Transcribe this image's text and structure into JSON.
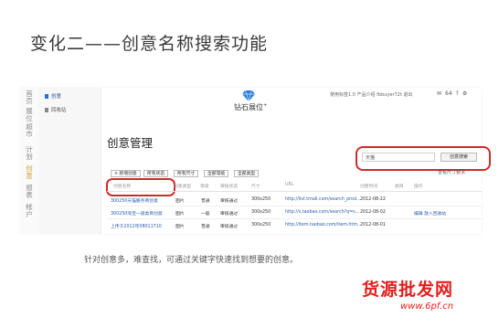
{
  "slide": {
    "title": "变化二——创意名称搜索功能",
    "caption": "针对创意多，难查找，可通过关键字快速找到想要的创意。"
  },
  "watermark": {
    "main": "货源批发网",
    "url": "www.6pf.cn"
  },
  "app": {
    "left_nav": [
      "首页",
      "展位超市",
      "计划",
      "创意",
      "报表",
      "帐户"
    ],
    "left_nav_active": "创意",
    "sub_nav": [
      "创意",
      "回收站"
    ],
    "logo_text": "钻石展位",
    "logo_sup": "+",
    "top_links": "使用标签1.0   产品介绍   fbbuyer72t   退出",
    "top_counts": "64",
    "page_title": "创意管理",
    "search": {
      "value": "天猫",
      "button": "创意搜索"
    },
    "size_link": "查看尺寸要求",
    "toolbar": [
      "+ 新增创意",
      "所有状态",
      "所有尺寸",
      "全部等级",
      "全部类型"
    ],
    "table": {
      "headers": [
        "创意名称",
        "创意类型",
        "等级",
        "审核状态",
        "尺寸",
        "URL",
        "创建时间",
        "类目",
        "操作"
      ],
      "rows": [
        [
          "300250天猫服务商创意",
          "图片",
          "普通",
          "审核通过",
          "300x250",
          "http://list.tmall.com/search_prod...",
          "2012-08-22",
          "",
          ""
        ],
        [
          "300250淘宝一级类目创意",
          "图片",
          "一般",
          "审核通过",
          "300x250",
          "http://s.taobao.com/search?q=s...",
          "2012-08-02",
          "",
          "编辑  放入回收站"
        ],
        [
          "上传于2012年08011710",
          "图片",
          "普通",
          "审核通过",
          "300x250",
          "http://item.taobao.com/item.htm...",
          "2012-08-01",
          "",
          ""
        ]
      ]
    }
  },
  "colors": {
    "highlight": "#d12a2a",
    "watermark": "#e2201d",
    "active_nav": "#d4a33c"
  },
  "icons": [
    "diamond-logo-icon",
    "mail-icon",
    "help-icon",
    "settings-icon"
  ]
}
